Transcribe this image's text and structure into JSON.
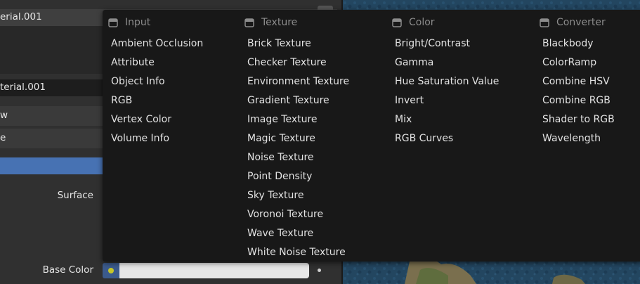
{
  "left_panel": {
    "slot_name": "erial.001",
    "material_name": "terial.001",
    "preview_label": "w",
    "e_label": "e",
    "surface_label": "Surface",
    "base_color_label": "Base Color"
  },
  "menu": {
    "columns": [
      {
        "title": "Input",
        "icon": "node-category-icon",
        "items": [
          "Ambient Occlusion",
          "Attribute",
          "Object Info",
          "RGB",
          "Vertex Color",
          "Volume Info"
        ]
      },
      {
        "title": "Texture",
        "icon": "node-category-icon",
        "items": [
          "Brick Texture",
          "Checker Texture",
          "Environment Texture",
          "Gradient Texture",
          "Image Texture",
          "Magic Texture",
          "Noise Texture",
          "Point Density",
          "Sky Texture",
          "Voronoi Texture",
          "Wave Texture",
          "White Noise Texture"
        ]
      },
      {
        "title": "Color",
        "icon": "node-category-icon",
        "items": [
          "Bright/Contrast",
          "Gamma",
          "Hue Saturation Value",
          "Invert",
          "Mix",
          "RGB Curves"
        ]
      },
      {
        "title": "Converter",
        "icon": "node-category-icon",
        "items": [
          "Blackbody",
          "ColorRamp",
          "Combine HSV",
          "Combine RGB",
          "Shader to RGB",
          "Wavelength"
        ]
      }
    ]
  },
  "colors": {
    "menu_bg": "#181818",
    "selection": "#4772b3",
    "socket_yellow": "#c7c729",
    "base_color_value": "#e7e7e7"
  }
}
